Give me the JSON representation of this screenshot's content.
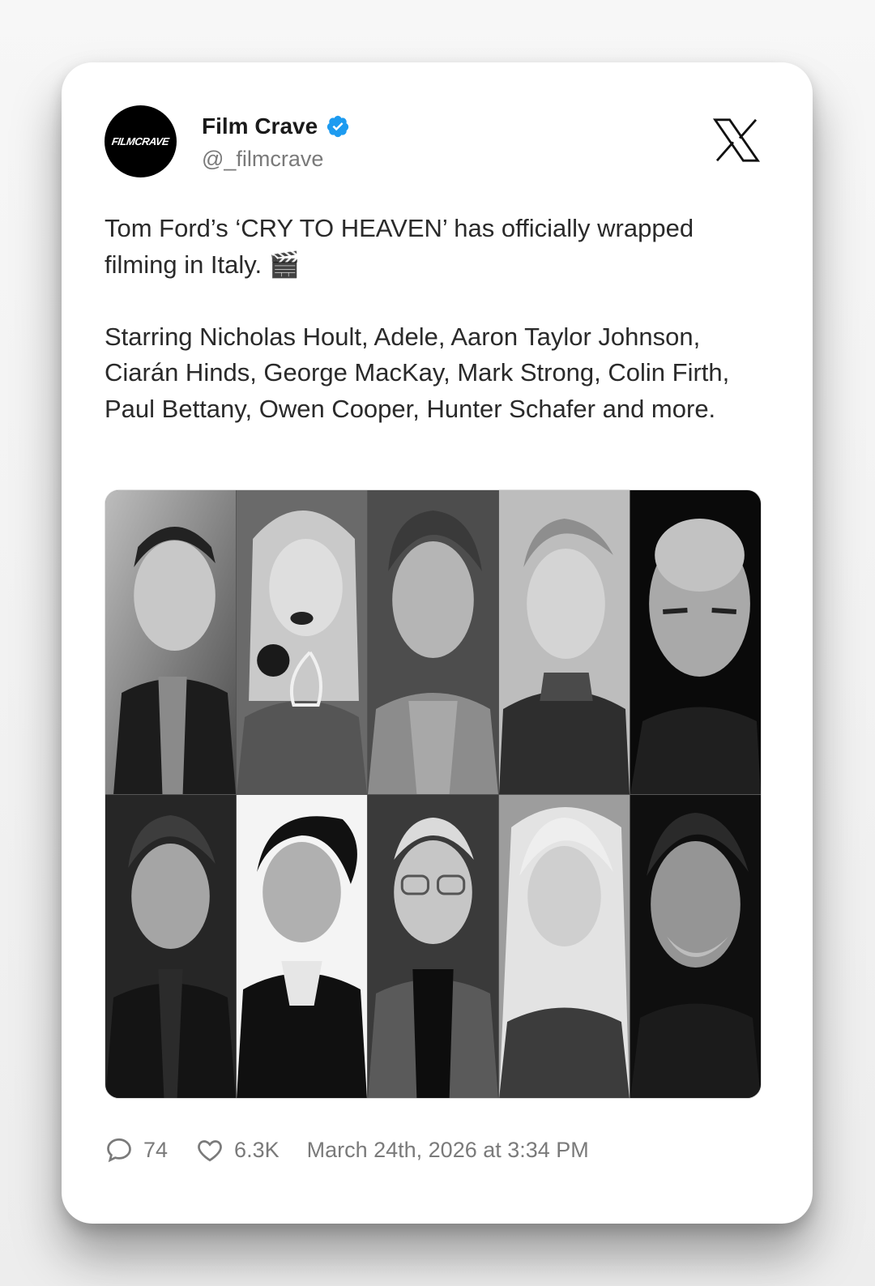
{
  "author": {
    "logo_text": "FILMCRAVE",
    "display_name": "Film Crave",
    "handle": "@_filmcrave",
    "verified": true
  },
  "tweet": {
    "paragraph_1": "Tom Ford’s ‘CRY TO HEAVEN’ has officially wrapped filming in Italy. 🎬",
    "paragraph_2": "Starring Nicholas Hoult, Adele, Aaron Taylor Johnson, Ciarán Hinds, George MacKay, Mark Strong, Colin Firth, Paul Bettany, Owen Cooper, Hunter Schafer and more."
  },
  "media": {
    "type": "black-and-white portrait collage",
    "tiles": 10
  },
  "footer": {
    "replies": "74",
    "likes": "6.3K",
    "timestamp": "March 24th, 2026 at 3:34 PM"
  },
  "icons": {
    "verified": "verified-badge-icon",
    "platform": "x-logo-icon",
    "reply": "reply-bubble-icon",
    "like": "heart-icon"
  },
  "colors": {
    "verified_blue": "#1d9bf0",
    "text_primary": "#1a1a1a",
    "text_secondary": "#7a7a7a",
    "card_bg": "#ffffff"
  }
}
